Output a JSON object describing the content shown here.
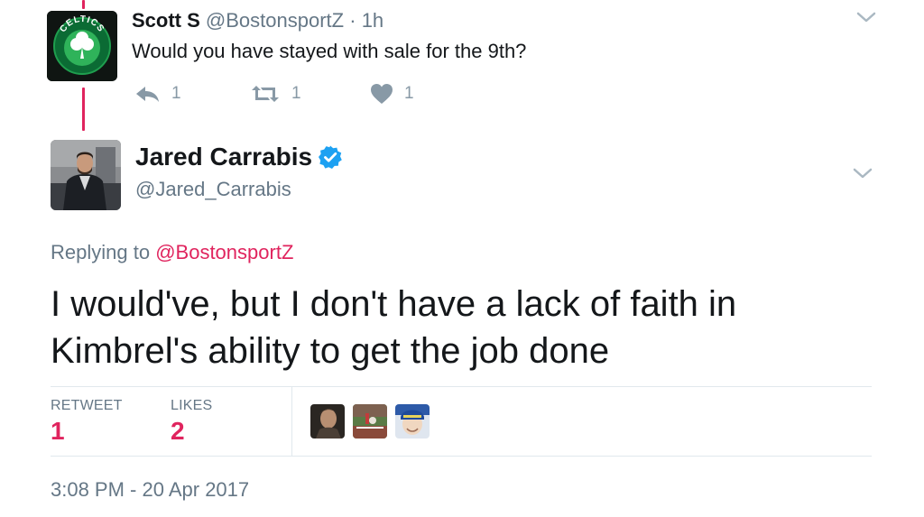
{
  "reply_tweet": {
    "name": "Scott S",
    "handle": "@BostonsportZ",
    "separator": "·",
    "time": "1h",
    "text": "Would you have stayed with sale for the 9th?",
    "reply_count": "1",
    "retweet_count": "1",
    "like_count": "1",
    "avatar_text": "CELTICS",
    "icons": {
      "reply": "reply-icon",
      "retweet": "retweet-icon",
      "like": "heart-icon",
      "more": "chevron-down-icon"
    }
  },
  "main_tweet": {
    "name": "Jared Carrabis",
    "verified": true,
    "handle": "@Jared_Carrabis",
    "replying_prefix": "Replying to",
    "replying_to": "@BostonsportZ",
    "text": "I would've, but I don't have a lack of faith in Kimbrel's ability to get the job done",
    "stats": {
      "retweet_label": "RETWEET",
      "retweet_value": "1",
      "likes_label": "LIKES",
      "likes_value": "2"
    },
    "timestamp": "3:08 PM - 20 Apr 2017",
    "icons": {
      "verified": "verified-badge-icon",
      "more": "chevron-down-icon"
    }
  },
  "colors": {
    "accent_red": "#e0245e",
    "secondary_text": "#657786",
    "action_grey": "#8899a6",
    "verified_blue": "#1da1f2",
    "divider": "#e1e8ed"
  }
}
